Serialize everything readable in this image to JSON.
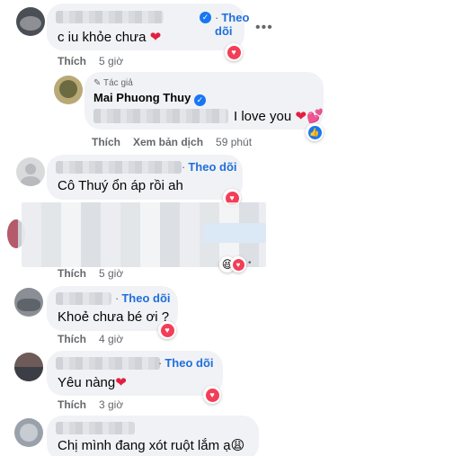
{
  "comments": [
    {
      "text": "c iu khỏe chưa",
      "emoji": "❤",
      "follow": "Theo dõi",
      "like": "Thích",
      "time": "5 giờ"
    },
    {
      "text": "Cô Thuý ổn áp rồi ah",
      "follow": "Theo dõi"
    },
    {
      "like": "Thích",
      "time": "5 giờ"
    },
    {
      "text": "Khoẻ chưa bé ơi ?",
      "follow": "Theo dõi",
      "like": "Thích",
      "time": "4 giờ"
    },
    {
      "text": "Yêu nàng",
      "emoji": "❤",
      "follow": "Theo dõi",
      "like": "Thích",
      "time": "3 giờ"
    },
    {
      "text": "Chị mình đang xót ruột lắm ạ",
      "emoji": "😩"
    }
  ],
  "reply": {
    "badge": "Tác giả",
    "name": "Mai Phuong Thuy",
    "text_visible": "I love you",
    "emoji": "❤💕",
    "like": "Thích",
    "translate": "Xem bản dịch",
    "time": "59 phút"
  },
  "icons": {
    "more": "more-horizontal-icon",
    "verified": "verified-badge-icon",
    "love": "love-reaction-icon",
    "like": "like-reaction-icon"
  },
  "colors": {
    "link": "#216fdb",
    "bubble": "#f0f2f5",
    "meta": "#65676b",
    "love": "#f33e58",
    "like": "#1877f2"
  }
}
